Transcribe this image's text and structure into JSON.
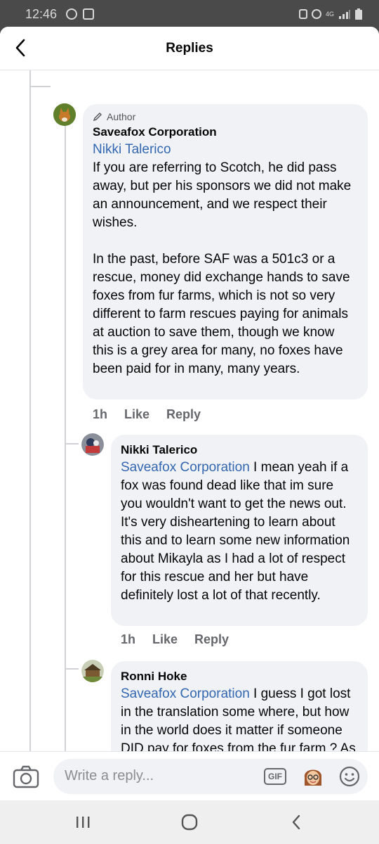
{
  "status_bar": {
    "time": "12:46",
    "network": "4G"
  },
  "header": {
    "title": "Replies"
  },
  "comments": [
    {
      "badge": "Author",
      "name": "Saveafox Corporation",
      "mention": "Nikki Talerico",
      "text": "If you are referring to Scotch, he did pass away, but per his sponsors we did not make an announcement, and we respect their wishes.\n\nIn the past, before SAF was a 501c3 or a rescue, money did exchange hands to save foxes from fur farms, which is not so very different to farm rescues paying for animals at auction to save them, though we know this is a grey area for many, no foxes have been paid for in many, many years.",
      "time": "1h",
      "like": "Like",
      "reply": "Reply"
    },
    {
      "name": "Nikki Talerico",
      "mention": "Saveafox Corporation",
      "text": " I mean yeah if a fox was found dead like that im sure you wouldn't want to get the news out. It's very disheartening to learn about this and to learn some new information about Mikayla as I had a lot of respect for this rescue and her but have definitely lost a lot of that recently.",
      "time": "1h",
      "like": "Like",
      "reply": "Reply"
    },
    {
      "name": "Ronni Hoke",
      "mention": "Saveafox Corporation",
      "text": " I guess I got lost in the translation some where, but how in the world does it matter if someone DID pay for foxes from the fur farm ?  As long as their lives"
    }
  ],
  "composer": {
    "placeholder": "Write a reply...",
    "gif_label": "GIF"
  },
  "icons": {
    "back": "back-arrow-icon",
    "camera": "camera-icon",
    "gif": "gif-icon",
    "avatar_sticker": "avatar-sticker-icon",
    "emoji": "emoji-icon",
    "pencil": "pencil-icon",
    "nav_recents": "recents-icon",
    "nav_home": "home-icon",
    "nav_back": "nav-back-icon"
  },
  "colors": {
    "link": "#3367b0",
    "bubble": "#f0f2f5",
    "muted": "#65676b"
  }
}
